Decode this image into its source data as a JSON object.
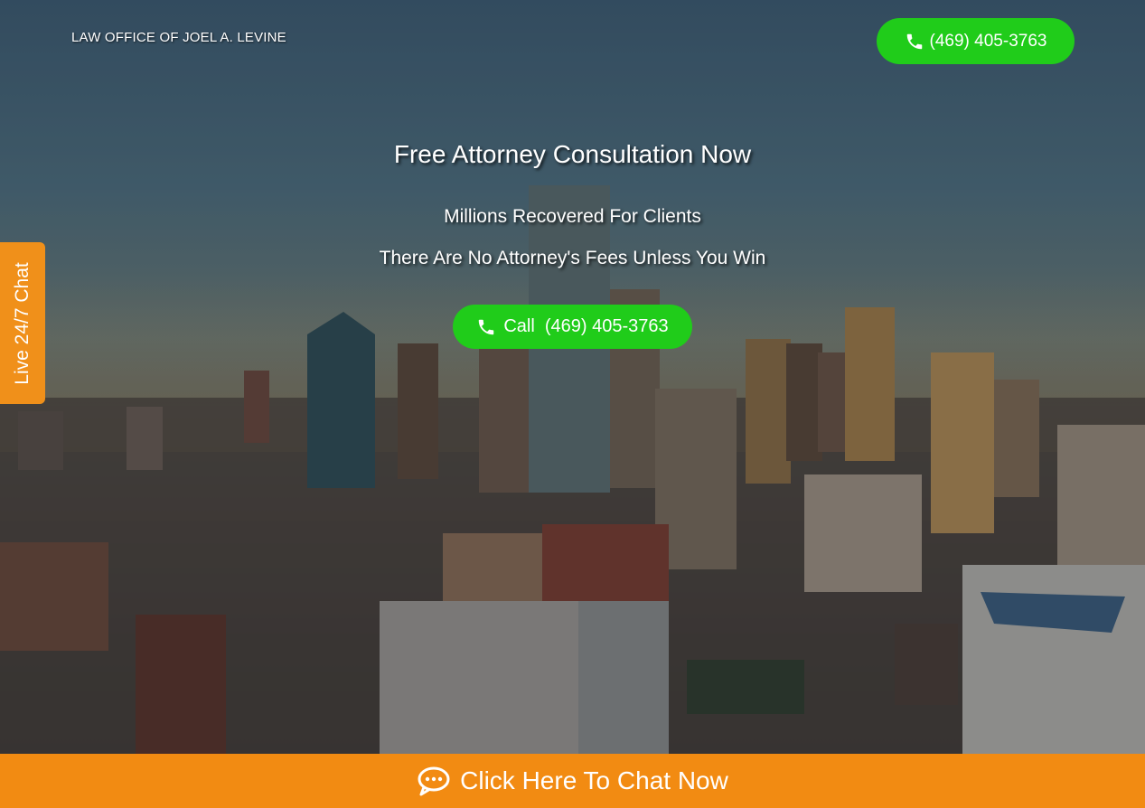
{
  "header": {
    "brand": "LAW OFFICE OF JOEL A. LEVINE",
    "phone_label": "(469) 405-3763",
    "phone_icon": "phone-icon"
  },
  "hero": {
    "headline": "Free Attorney Consultation Now",
    "subline1": "Millions Recovered For Clients",
    "subline2": "There Are No Attorney's Fees Unless You Win",
    "cta_label": "Call  (469) 405-3763",
    "cta_icon": "phone-icon"
  },
  "side_tab": {
    "label": "Live 24/7 Chat"
  },
  "chat_bar": {
    "label": "Click Here To Chat Now",
    "icon": "chat-bubble-icon"
  },
  "colors": {
    "button_green": "#20cc1a",
    "chat_orange": "#f28b12",
    "side_tab_orange": "#f0901a"
  }
}
